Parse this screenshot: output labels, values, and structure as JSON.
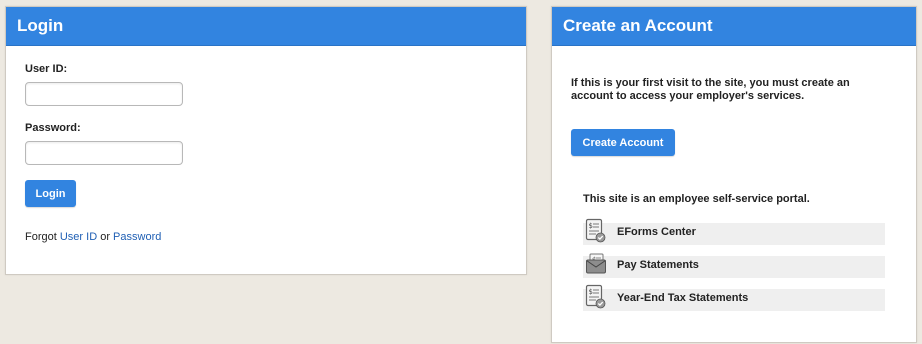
{
  "login": {
    "title": "Login",
    "user_id_label": "User ID:",
    "user_id_value": "",
    "password_label": "Password:",
    "password_value": "",
    "login_button": "Login",
    "forgot_prefix": "Forgot ",
    "forgot_user_id": "User ID",
    "forgot_or": " or ",
    "forgot_password": "Password"
  },
  "create_account": {
    "title": "Create an Account",
    "intro": "If this is your first visit to the site, you must create an account to access your employer's services.",
    "button": "Create Account",
    "portal_text": "This site is an employee self-service portal.",
    "services": [
      {
        "label": "EForms Center",
        "icon": "form-document-icon"
      },
      {
        "label": "Pay Statements",
        "icon": "pay-envelope-icon"
      },
      {
        "label": "Year-End Tax Statements",
        "icon": "tax-document-icon"
      }
    ]
  },
  "colors": {
    "accent": "#3284e0",
    "link": "#1f5fb4",
    "background": "#ede9e1",
    "item_background": "#efefef"
  }
}
